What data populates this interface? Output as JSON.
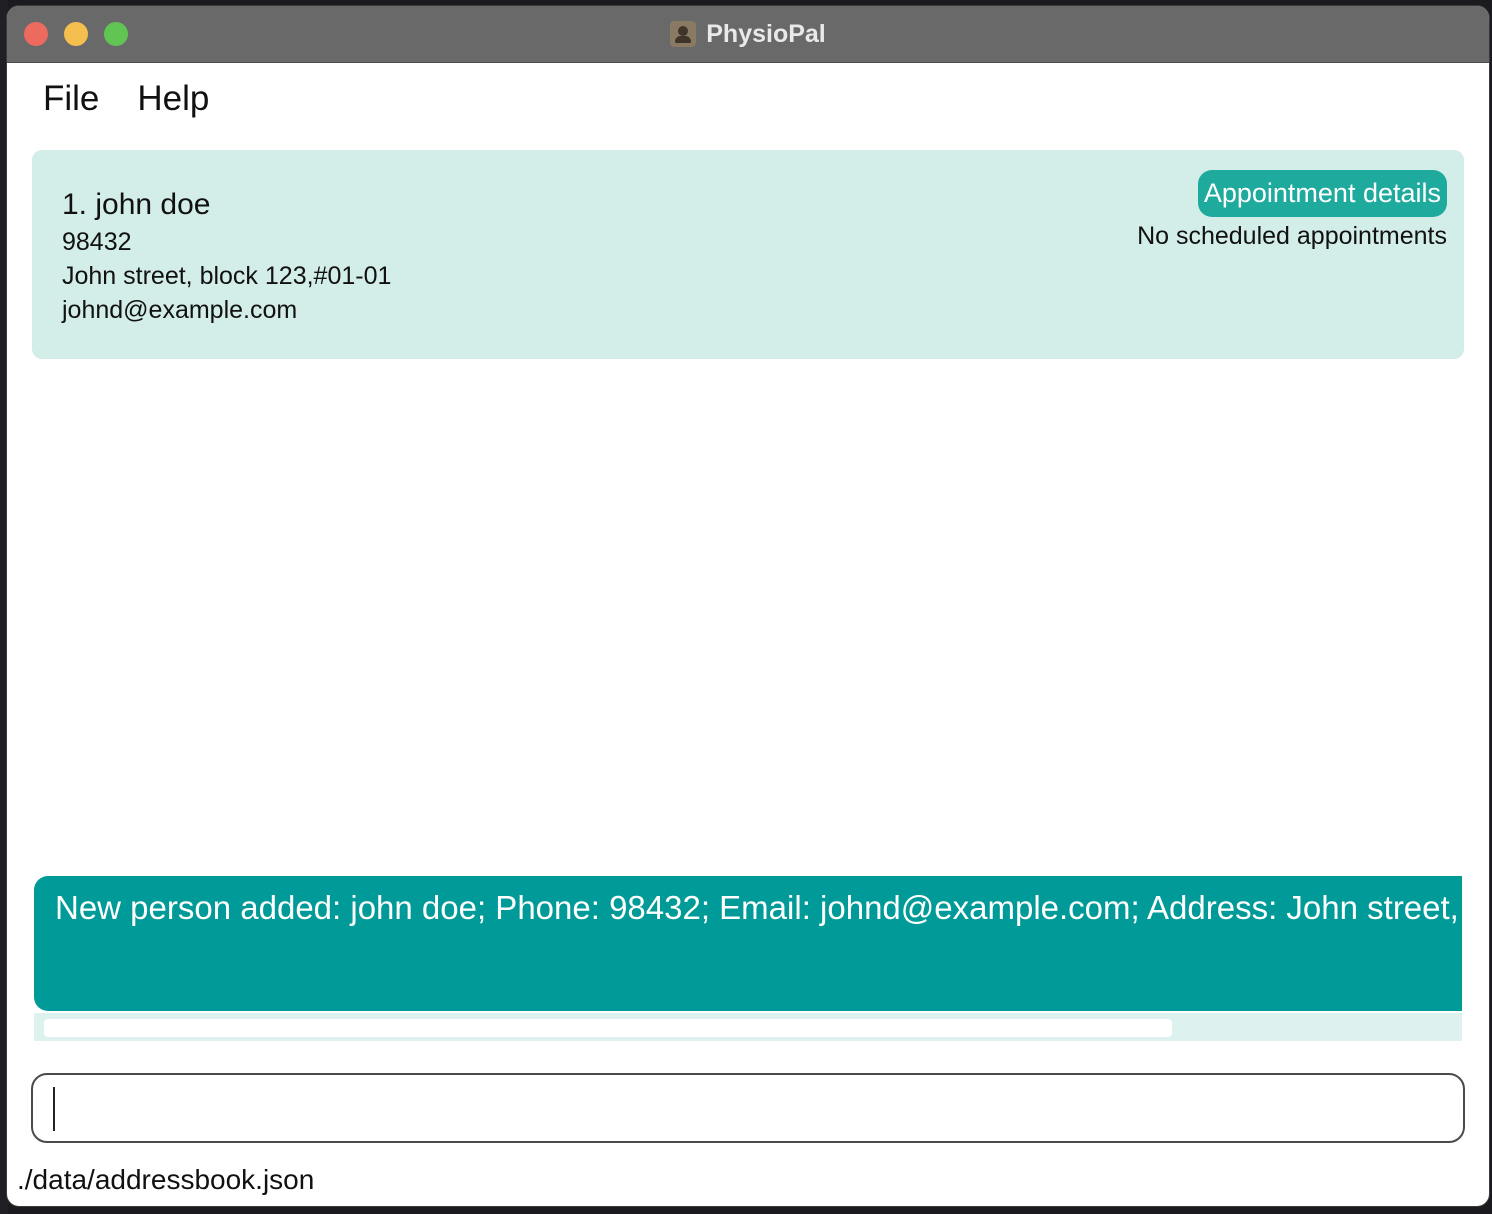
{
  "window": {
    "title": "PhysioPal"
  },
  "menubar": {
    "items": [
      {
        "label": "File"
      },
      {
        "label": "Help"
      }
    ]
  },
  "person_list": [
    {
      "name": "1. john doe",
      "phone": "98432",
      "address": "John street, block 123,#01-01",
      "email": "johnd@example.com",
      "appointment_button_label": "Appointment details",
      "appointment_status": "No scheduled appointments"
    }
  ],
  "result_display": {
    "text": "New person added: john doe; Phone: 98432; Email: johnd@example.com; Address: John street, bl"
  },
  "command_box": {
    "value": ""
  },
  "status_bar": {
    "file_path": "./data/addressbook.json"
  },
  "colors": {
    "card_background": "#d3ede9",
    "accent_button": "#1eaa9d",
    "result_background": "#009b98",
    "titlebar": "#696969"
  },
  "icons": {
    "app_icon": "contacts-app-icon"
  }
}
